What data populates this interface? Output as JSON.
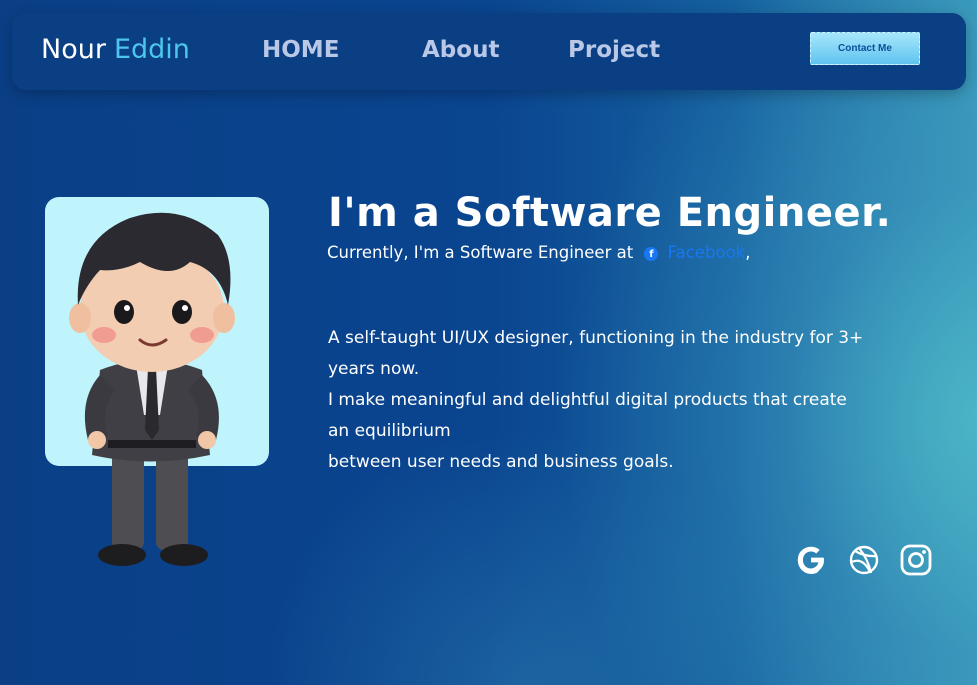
{
  "nav": {
    "brand_first": "Nour",
    "brand_second": "Eddin",
    "links": [
      "HOME",
      "About",
      "Project"
    ],
    "contact_label": "Contact Me"
  },
  "hero": {
    "headline": "I'm a Software Engineer.",
    "subline_prefix": "Currently, I'm a Software Engineer at",
    "company": "Facebook",
    "subline_suffix": ","
  },
  "bio": {
    "lines": [
      "A self-taught UI/UX designer, functioning in the industry for 3+ years now.",
      "I make meaningful and delightful digital products that create an equilibrium",
      "between user needs and business goals."
    ]
  },
  "social": {
    "icons": [
      "google-icon",
      "dribbble-icon",
      "instagram-icon"
    ]
  },
  "colors": {
    "accent": "#4dc6ec",
    "nav_bg": "#0b3f84",
    "facebook": "#1877f2",
    "avatar_bg": "#bff4fc"
  }
}
